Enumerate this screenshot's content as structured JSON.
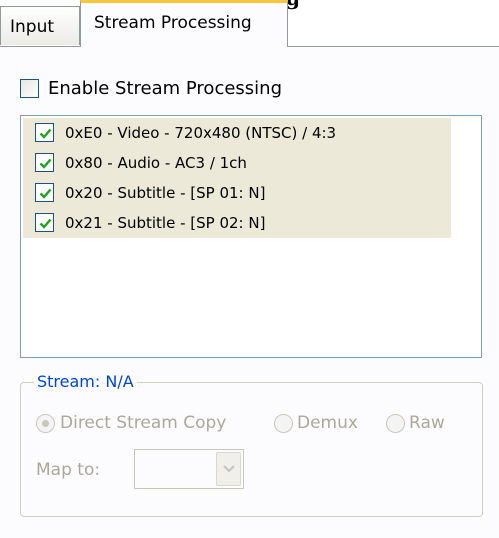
{
  "clipped_header": "g",
  "tabs": [
    {
      "label": "Input",
      "active": false
    },
    {
      "label": "Stream Processing",
      "active": true
    }
  ],
  "enable": {
    "label": "Enable Stream Processing",
    "checked": false
  },
  "streams": [
    {
      "label": "0xE0 - Video - 720x480 (NTSC) / 4:3",
      "checked": true
    },
    {
      "label": "0x80 - Audio - AC3 / 1ch",
      "checked": true
    },
    {
      "label": "0x20 - Subtitle - [SP 01: N]",
      "checked": true
    },
    {
      "label": "0x21 - Subtitle - [SP 02: N]",
      "checked": true
    }
  ],
  "stream_group": {
    "title": "Stream: N/A",
    "options": [
      "Direct Stream Copy",
      "Demux",
      "Raw"
    ],
    "selected": "Direct Stream Copy",
    "map_label": "Map to:",
    "map_value": ""
  },
  "colors": {
    "check": "#21a121",
    "group_title": "#0046d5",
    "disabled": "#aca899",
    "tab_highlight": "#ffc73c"
  }
}
